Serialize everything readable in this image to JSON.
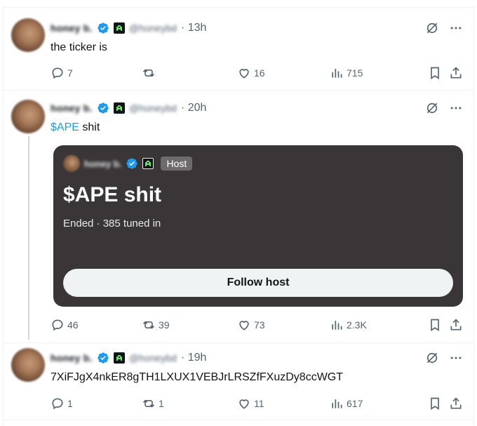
{
  "tweets": [
    {
      "author_name": "honey b.",
      "handle": "@honeybd",
      "time": "13h",
      "text": "the ticker is",
      "replies": "7",
      "retweets": "",
      "likes": "16",
      "views": "715"
    },
    {
      "author_name": "honey b.",
      "handle": "@honeybd",
      "time": "20h",
      "cashtag": "$APE",
      "text_after": " shit",
      "replies": "46",
      "retweets": "39",
      "likes": "73",
      "views": "2.3K"
    },
    {
      "author_name": "honey b.",
      "handle": "@honeybd",
      "time": "19h",
      "text": "7XiFJgX4nkER8gTH1LXUX1VEBJrLRSZfFXuzDy8ccWGT",
      "replies": "1",
      "retweets": "1",
      "likes": "11",
      "views": "617"
    }
  ],
  "space": {
    "host_name": "honey b.",
    "host_label": "Host",
    "title": "$APE shit",
    "status": "Ended · 385 tuned in",
    "follow_label": "Follow host"
  },
  "colors": {
    "accent": "#1d9bf0",
    "muted": "#536471",
    "card_bg": "#3a3638"
  },
  "icons": [
    "verified-badge-icon",
    "community-badge-icon",
    "grok-slash-icon",
    "more-icon",
    "reply-icon",
    "retweet-icon",
    "like-icon",
    "views-icon",
    "bookmark-icon",
    "share-icon"
  ]
}
